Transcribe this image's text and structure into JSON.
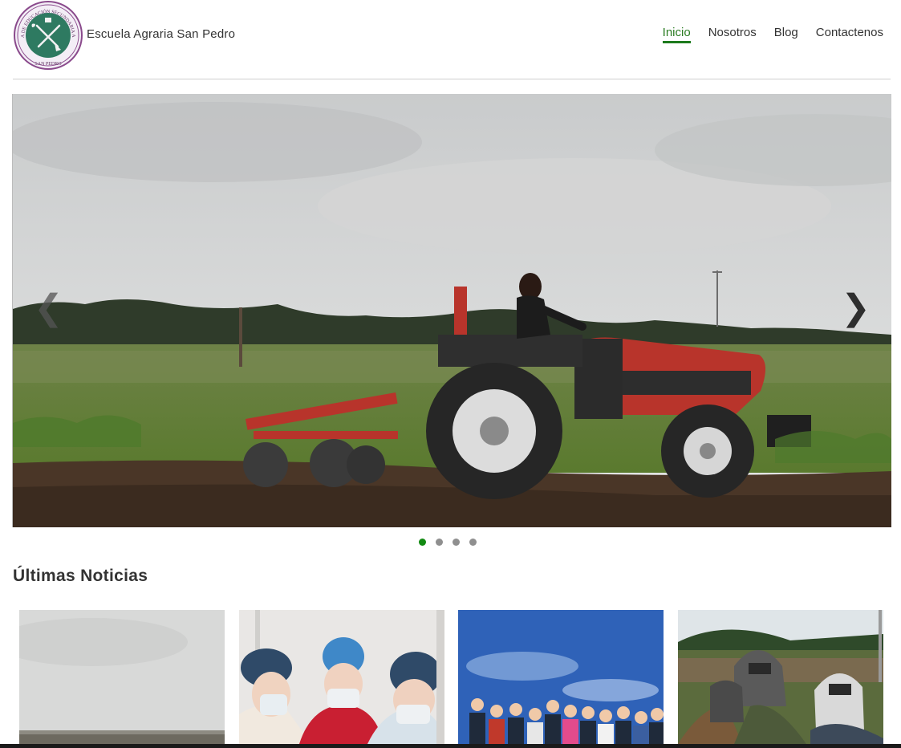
{
  "header": {
    "site_name": "Escuela Agraria San Pedro",
    "logo": {
      "icon": "crossed-tools-seal",
      "ring_text": "ESCUELA DE EDUCACIÓN SECUNDARIA AGRARIA",
      "bottom_text": "SAN PEDRO"
    },
    "nav": [
      {
        "label": "Inicio",
        "active": true
      },
      {
        "label": "Nosotros",
        "active": false
      },
      {
        "label": "Blog",
        "active": false
      },
      {
        "label": "Contactenos",
        "active": false
      }
    ]
  },
  "carousel": {
    "prev_icon": "❮",
    "next_icon": "❯",
    "slide_count": 4,
    "active_slide": 1
  },
  "news": {
    "title": "Últimas Noticias"
  },
  "colors": {
    "accent_green": "#138a13",
    "nav_active": "#2c7d24",
    "tractor_red": "#b8342b"
  }
}
